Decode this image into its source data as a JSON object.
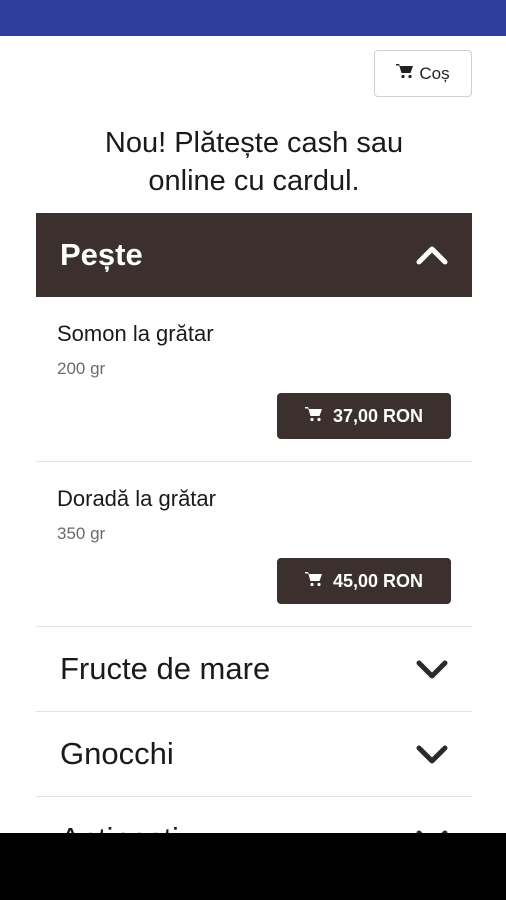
{
  "cart": {
    "label": "Coș",
    "icon": "cart-icon"
  },
  "promo": {
    "line1": "Nou! Plătește cash sau",
    "line2": "online cu cardul."
  },
  "categories": [
    {
      "title": "Pește",
      "expanded": true,
      "items": [
        {
          "name": "Somon la grătar",
          "weight": "200 gr",
          "price": "37,00 RON"
        },
        {
          "name": "Doradă la grătar",
          "weight": "350 gr",
          "price": "45,00 RON"
        }
      ]
    },
    {
      "title": "Fructe de mare",
      "expanded": false
    },
    {
      "title": "Gnocchi",
      "expanded": false
    },
    {
      "title": "Antipasti",
      "expanded": false
    }
  ],
  "colors": {
    "statusBar": "#2f3e9e",
    "accent": "#3b302d",
    "navBar": "#000000"
  }
}
